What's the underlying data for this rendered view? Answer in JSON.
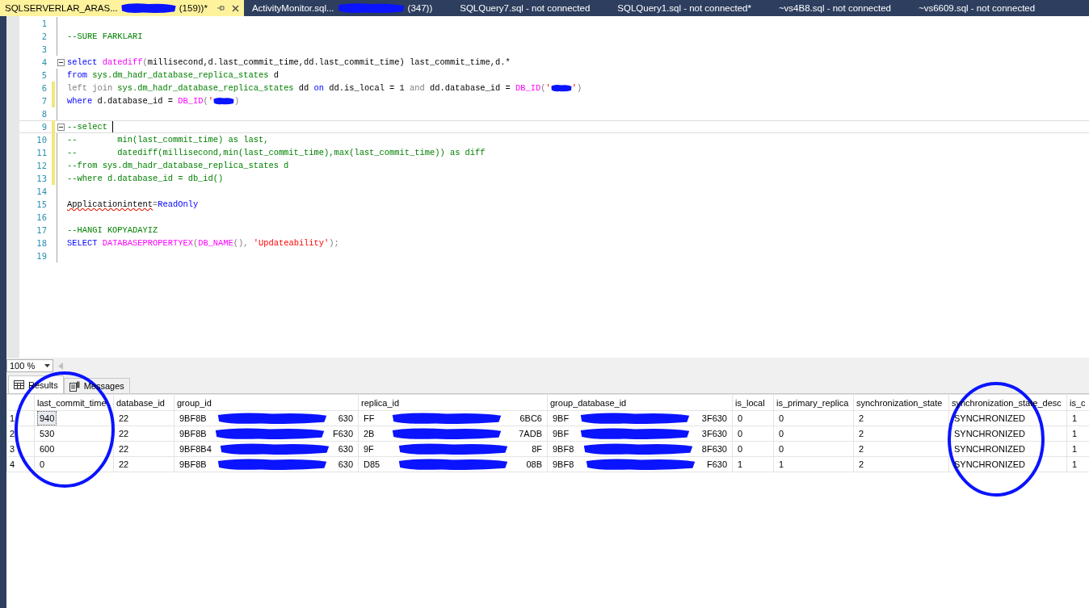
{
  "tabs": [
    {
      "start": "SQLSERVERLAR_ARAS...",
      "end": "(159))*",
      "selected": true
    },
    {
      "start": "ActivityMonitor.sql...",
      "end": "(347))",
      "selected": false
    },
    {
      "start": "SQLQuery7.sql - not connected",
      "selected": false
    },
    {
      "start": "SQLQuery1.sql - not connected*",
      "selected": false
    },
    {
      "start": "~vs4B8.sql - not connected",
      "selected": false
    },
    {
      "start": "~vs6609.sql - not connected",
      "selected": false
    }
  ],
  "editor": {
    "lines": [
      {
        "number": "1",
        "changed": false,
        "current": false,
        "fold": false
      },
      {
        "number": "2",
        "changed": false,
        "current": false,
        "fold": false,
        "tokens": [
          {
            "kind": "comment",
            "t": "--SURE FARKLARI"
          }
        ]
      },
      {
        "number": "3",
        "changed": false,
        "current": false,
        "fold": false
      },
      {
        "number": "4",
        "changed": false,
        "current": false,
        "fold": true,
        "tokens": [
          {
            "kind": "keyword",
            "t": "select"
          },
          {
            "kind": "function",
            "t": " datediff"
          },
          {
            "kind": "operator",
            "t": "("
          },
          {
            "kind": "plain",
            "t": "millisecond,d.last_commit_time,dd.last_commit_time) last_commit_time,d.*"
          }
        ]
      },
      {
        "number": "5",
        "changed": false,
        "current": false,
        "fold": false,
        "tokens": [
          {
            "kind": "keyword",
            "t": "from"
          },
          {
            "kind": "system",
            "t": " sys.dm_hadr_database_replica_states"
          },
          {
            "kind": "plain",
            "t": " d"
          }
        ]
      },
      {
        "number": "6",
        "changed": true,
        "current": false,
        "fold": false,
        "tokens": [
          {
            "kind": "operator",
            "t": "left join"
          },
          {
            "kind": "system",
            "t": " sys.dm_hadr_database_replica_states"
          },
          {
            "kind": "plain",
            "t": " dd"
          },
          {
            "kind": "keyword",
            "t": " on"
          },
          {
            "kind": "plain",
            "t": " dd.is_local = 1"
          },
          {
            "kind": "operator",
            "t": " and"
          },
          {
            "kind": "plain",
            "t": " dd.database_id ="
          },
          {
            "kind": "function",
            "t": " DB_ID"
          },
          {
            "kind": "operator",
            "t": "("
          },
          {
            "kind": "string",
            "t": "'"
          },
          {
            "kind": "redaction"
          },
          {
            "kind": "string",
            "t": "'"
          },
          {
            "kind": "operator",
            "t": ")"
          }
        ]
      },
      {
        "number": "7",
        "changed": true,
        "current": false,
        "fold": false,
        "tokens": [
          {
            "kind": "keyword",
            "t": "where"
          },
          {
            "kind": "plain",
            "t": " d.database_id ="
          },
          {
            "kind": "function",
            "t": " DB_ID"
          },
          {
            "kind": "operator",
            "t": "("
          },
          {
            "kind": "string",
            "t": "'"
          },
          {
            "kind": "redaction"
          },
          {
            "kind": "operator",
            "t": ")"
          }
        ]
      },
      {
        "number": "8",
        "changed": false,
        "current": false,
        "fold": false
      },
      {
        "number": "9",
        "changed": true,
        "current": true,
        "fold": true,
        "tokens": [
          {
            "kind": "comment",
            "t": "--select"
          }
        ]
      },
      {
        "number": "10",
        "changed": true,
        "current": false,
        "fold": false,
        "tokens": [
          {
            "kind": "comment",
            "t": "--        min(last_commit_time) as last,"
          }
        ]
      },
      {
        "number": "11",
        "changed": true,
        "current": false,
        "fold": false,
        "tokens": [
          {
            "kind": "comment",
            "t": "--        datediff(millisecond,min(last_commit_time),max(last_commit_time)) as diff"
          }
        ]
      },
      {
        "number": "12",
        "changed": true,
        "current": false,
        "fold": false,
        "tokens": [
          {
            "kind": "comment",
            "t": "--from sys.dm_hadr_database_replica_states d"
          }
        ]
      },
      {
        "number": "13",
        "changed": true,
        "current": false,
        "fold": false,
        "tokens": [
          {
            "kind": "comment",
            "t": "--where d.database_id = db_id()"
          }
        ]
      },
      {
        "number": "14",
        "changed": false,
        "current": false,
        "fold": false
      },
      {
        "number": "15",
        "changed": false,
        "current": false,
        "fold": false,
        "tokens": [
          {
            "kind": "error",
            "t": "Applicationintent"
          },
          {
            "kind": "operator",
            "t": "="
          },
          {
            "kind": "keyword",
            "t": "ReadOnly"
          }
        ]
      },
      {
        "number": "16",
        "changed": false,
        "current": false,
        "fold": false
      },
      {
        "number": "17",
        "changed": false,
        "current": false,
        "fold": false,
        "tokens": [
          {
            "kind": "comment",
            "t": "--HANGI KOPYADAYIZ"
          }
        ]
      },
      {
        "number": "18",
        "changed": false,
        "current": false,
        "fold": false,
        "tokens": [
          {
            "kind": "keyword",
            "t": "SELECT"
          },
          {
            "kind": "function",
            "t": " DATABASEPROPERTYEX"
          },
          {
            "kind": "operator",
            "t": "("
          },
          {
            "kind": "function",
            "t": "DB_NAME"
          },
          {
            "kind": "operator",
            "t": "(),"
          },
          {
            "kind": "string",
            "t": " 'Updateability'"
          },
          {
            "kind": "operator",
            "t": ");"
          }
        ]
      },
      {
        "number": "19",
        "changed": false,
        "current": false,
        "fold": false
      }
    ]
  },
  "zoom": {
    "value": "100 %"
  },
  "result_tabs": [
    {
      "label": "Results",
      "kind": "grid",
      "selected": true
    },
    {
      "label": "Messages",
      "kind": "messages",
      "selected": false
    }
  ],
  "grid": {
    "columns": [
      "last_commit_time",
      "database_id",
      "group_id",
      "replica_id",
      "group_database_id",
      "is_local",
      "is_primary_replica",
      "synchronization_state",
      "synchronization_state_desc",
      "is_c"
    ],
    "rows": [
      {
        "number": "1",
        "cells": [
          {
            "text": "940",
            "selected": true
          },
          {
            "text": "22",
            "selected": false
          },
          {
            "start": "9BF8B",
            "end": "630",
            "selected": false
          },
          {
            "start": "FF",
            "end": "6BC6",
            "selected": false
          },
          {
            "start": "9BF",
            "end": "3F630",
            "selected": false
          },
          {
            "text": "0",
            "selected": false
          },
          {
            "text": "0",
            "selected": false
          },
          {
            "text": "2",
            "selected": false
          },
          {
            "text": "SYNCHRONIZED",
            "selected": false
          },
          {
            "text": "1",
            "selected": false
          }
        ]
      },
      {
        "number": "2",
        "cells": [
          {
            "text": "530",
            "selected": false
          },
          {
            "text": "22",
            "selected": false
          },
          {
            "start": "9BF8B",
            "end": "F630",
            "selected": false
          },
          {
            "start": "2B",
            "end": "7ADB",
            "selected": false
          },
          {
            "start": "9BF",
            "end": "3F630",
            "selected": false
          },
          {
            "text": "0",
            "selected": false
          },
          {
            "text": "0",
            "selected": false
          },
          {
            "text": "2",
            "selected": false
          },
          {
            "text": "SYNCHRONIZED",
            "selected": false
          },
          {
            "text": "1",
            "selected": false
          }
        ]
      },
      {
        "number": "3",
        "cells": [
          {
            "text": "600",
            "selected": false
          },
          {
            "text": "22",
            "selected": false
          },
          {
            "start": "9BF8B4",
            "end": "630",
            "selected": false
          },
          {
            "start": "9F",
            "end": "8F",
            "selected": false
          },
          {
            "start": "9BF8",
            "end": "8F630",
            "selected": false
          },
          {
            "text": "0",
            "selected": false
          },
          {
            "text": "0",
            "selected": false
          },
          {
            "text": "2",
            "selected": false
          },
          {
            "text": "SYNCHRONIZED",
            "selected": false
          },
          {
            "text": "1",
            "selected": false
          }
        ]
      },
      {
        "number": "4",
        "cells": [
          {
            "text": "0",
            "selected": false
          },
          {
            "text": "22",
            "selected": false
          },
          {
            "start": "9BF8B",
            "end": "630",
            "selected": false
          },
          {
            "start": "D85",
            "end": "08B",
            "selected": false
          },
          {
            "start": "9BF8",
            "end": "F630",
            "selected": false
          },
          {
            "text": "1",
            "selected": false
          },
          {
            "text": "1",
            "selected": false
          },
          {
            "text": "2",
            "selected": false
          },
          {
            "text": "SYNCHRONIZED",
            "selected": false
          },
          {
            "text": "1",
            "selected": false
          }
        ]
      }
    ]
  }
}
